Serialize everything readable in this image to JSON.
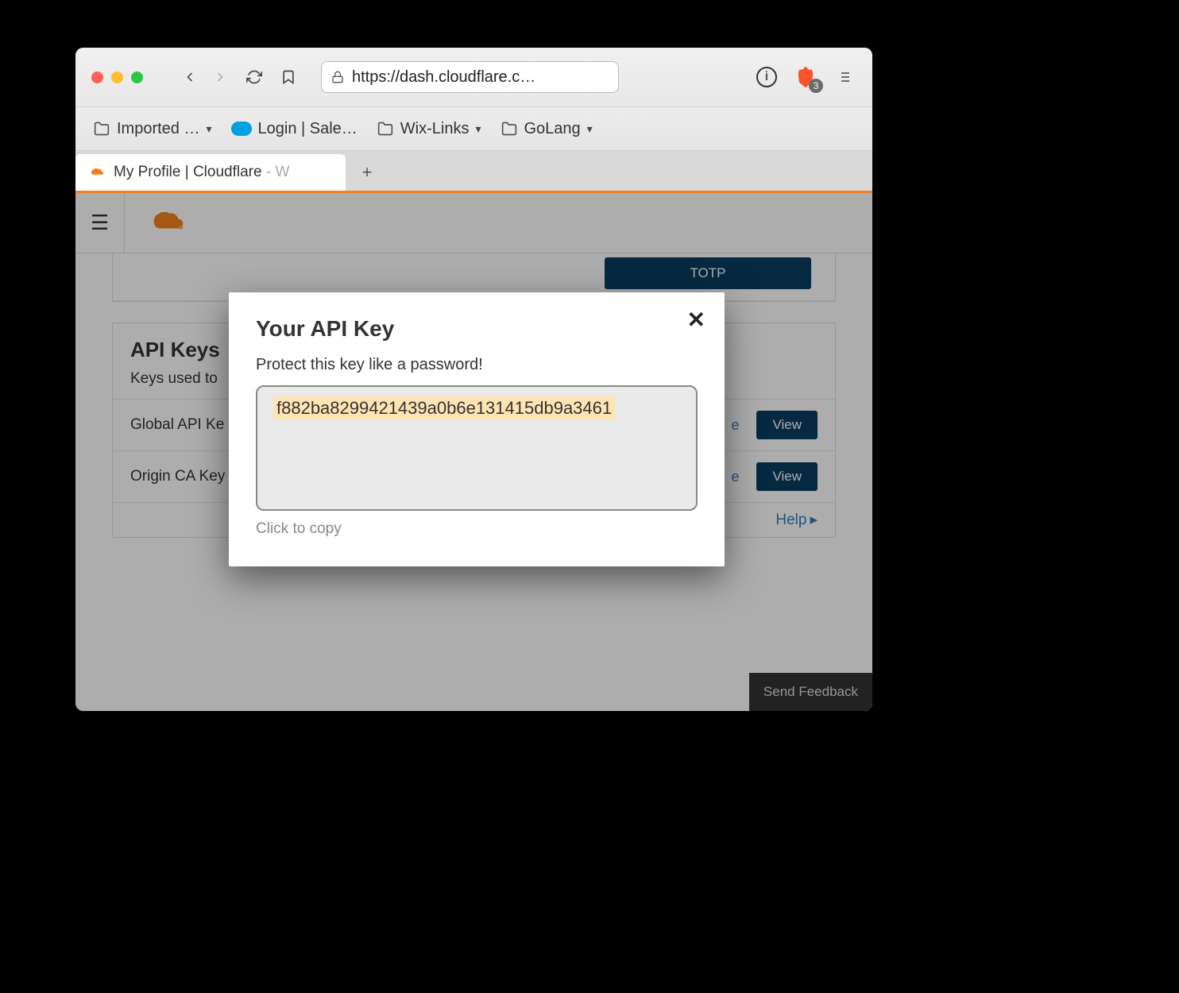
{
  "browser": {
    "url": "https://dash.cloudflare.c…",
    "badge_count": "3",
    "bookmarks": [
      {
        "label": "Imported …",
        "has_chevron": true
      },
      {
        "label": "Login | Sale…",
        "salesforce": true
      },
      {
        "label": "Wix-Links",
        "has_chevron": true
      },
      {
        "label": "GoLang",
        "has_chevron": true
      }
    ],
    "tab_title": "My Profile | Cloudflare",
    "tab_suffix": " - W"
  },
  "page": {
    "totp_label": "TOTP",
    "api_keys_heading": "API Keys",
    "api_keys_desc": "Keys used to",
    "rows": [
      {
        "label": "Global API Ke",
        "change": "e",
        "view": "View"
      },
      {
        "label": "Origin CA Key",
        "change": "e",
        "view": "View"
      }
    ],
    "help": "Help",
    "feedback": "Send Feedback"
  },
  "modal": {
    "title": "Your API Key",
    "warn": "Protect this key like a password!",
    "key": "f882ba8299421439a0b6e131415db9a3461",
    "copy_hint": "Click to copy"
  }
}
